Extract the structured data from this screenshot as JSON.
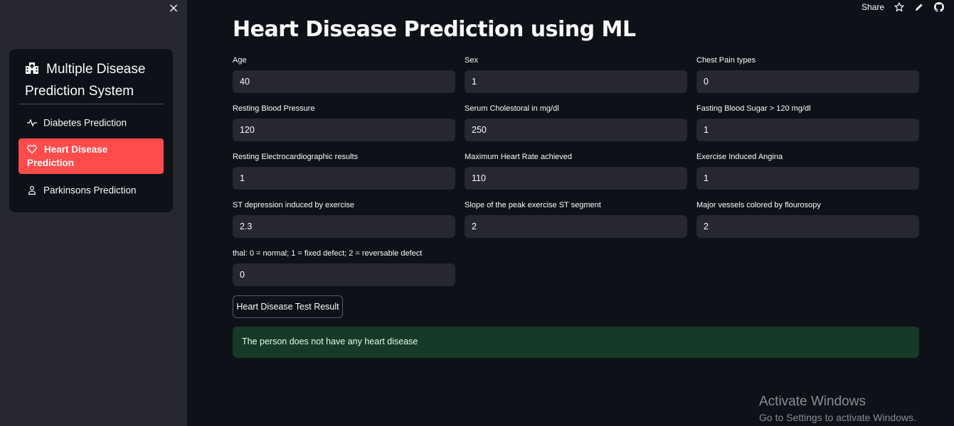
{
  "sidebar": {
    "close_symbol": "×",
    "menu_title": "Multiple Disease Prediction System",
    "title_icon": "hospital-icon",
    "items": [
      {
        "label": "Diabetes Prediction",
        "icon": "activity-icon",
        "active": false
      },
      {
        "label": "Heart Disease Prediction",
        "icon": "heart-icon",
        "active": true
      },
      {
        "label": "Parkinsons Prediction",
        "icon": "person-icon",
        "active": false
      }
    ]
  },
  "toolbar": {
    "share_label": "Share",
    "icons": [
      "star-icon",
      "edit-icon",
      "github-icon"
    ]
  },
  "page": {
    "title": "Heart Disease Prediction using ML"
  },
  "fields": [
    {
      "label": "Age",
      "value": "40"
    },
    {
      "label": "Sex",
      "value": "1"
    },
    {
      "label": "Chest Pain types",
      "value": "0"
    },
    {
      "label": "Resting Blood Pressure",
      "value": "120"
    },
    {
      "label": "Serum Cholestoral in mg/dl",
      "value": "250"
    },
    {
      "label": "Fasting Blood Sugar > 120 mg/dl",
      "value": "1"
    },
    {
      "label": "Resting Electrocardiographic results",
      "value": "1"
    },
    {
      "label": "Maximum Heart Rate achieved",
      "value": "110"
    },
    {
      "label": "Exercise Induced Angina",
      "value": "1"
    },
    {
      "label": "ST depression induced by exercise",
      "value": "2.3"
    },
    {
      "label": "Slope of the peak exercise ST segment",
      "value": "2"
    },
    {
      "label": "Major vessels colored by flourosopy",
      "value": "2"
    },
    {
      "label": "thal: 0 = normal; 1 = fixed defect; 2 = reversable defect",
      "value": "0"
    }
  ],
  "result_button_label": "Heart Disease Test Result",
  "result_message": "The person does not have any heart disease",
  "watermark": {
    "title": "Activate Windows",
    "subtitle": "Go to Settings to activate Windows."
  },
  "colors": {
    "background": "#0e1117",
    "sidebar": "#262730",
    "accent": "#ff4b4b",
    "success_bg": "#173928"
  }
}
